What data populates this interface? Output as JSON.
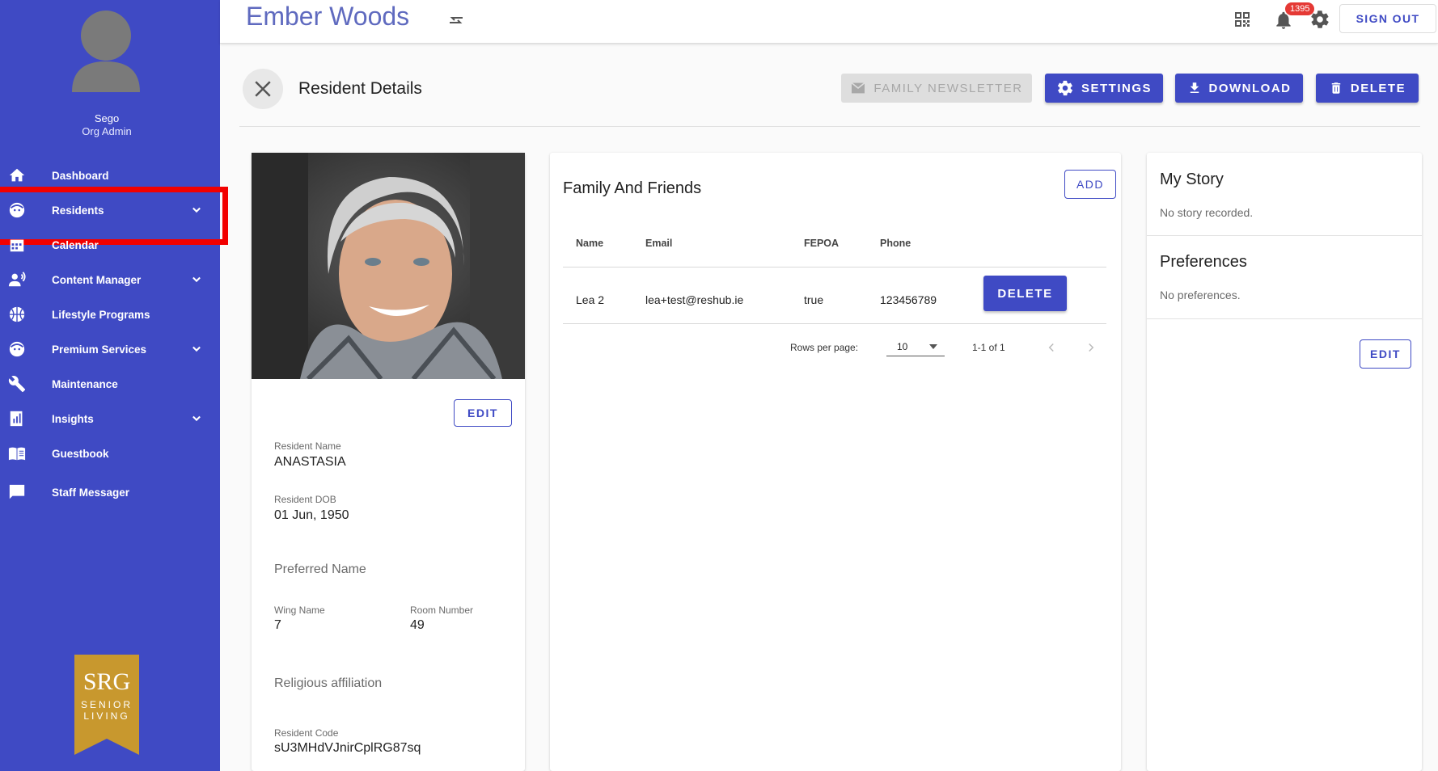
{
  "sidebar": {
    "user_name": "Sego",
    "user_role": "Org Admin",
    "items": [
      {
        "label": "Dashboard",
        "icon": "home-icon"
      },
      {
        "label": "Residents",
        "icon": "face-icon"
      },
      {
        "label": "Calendar",
        "icon": "calendar-icon"
      },
      {
        "label": "Content Manager",
        "icon": "person-voice-icon"
      },
      {
        "label": "Lifestyle Programs",
        "icon": "basketball-icon"
      },
      {
        "label": "Premium Services",
        "icon": "face-icon"
      },
      {
        "label": "Maintenance",
        "icon": "wrench-icon"
      },
      {
        "label": "Insights",
        "icon": "insights-icon"
      },
      {
        "label": "Guestbook",
        "icon": "book-icon"
      },
      {
        "label": "Staff Messager",
        "icon": "chat-icon"
      }
    ],
    "logo": {
      "line1": "SRG",
      "line2": "SENIOR",
      "line3": "LIVING"
    }
  },
  "topbar": {
    "title": "Ember Woods",
    "notification_count": "1395",
    "signout_label": "SIGN OUT"
  },
  "header": {
    "title": "Resident Details",
    "buttons": {
      "newsletter": "FAMILY NEWSLETTER",
      "settings": "SETTINGS",
      "download": "DOWNLOAD",
      "delete": "DELETE"
    }
  },
  "profile": {
    "edit_label": "EDIT",
    "resident_name_label": "Resident Name",
    "resident_name": "ANASTASIA",
    "dob_label": "Resident DOB",
    "dob": "01 Jun, 1950",
    "preferred_name_label": "Preferred Name",
    "wing_label": "Wing Name",
    "wing": "7",
    "room_label": "Room Number",
    "room": "49",
    "religion_label": "Religious affiliation",
    "code_label": "Resident Code",
    "code": "sU3MHdVJnirCplRG87sq"
  },
  "family": {
    "title": "Family And Friends",
    "add_label": "ADD",
    "columns": [
      "Name",
      "Email",
      "FEPOA",
      "Phone"
    ],
    "rows": [
      {
        "name": "Lea 2",
        "email": "lea+test@reshub.ie",
        "fepoa": "true",
        "phone": "123456789",
        "action": "DELETE"
      }
    ],
    "pagination": {
      "rows_per_page_label": "Rows per page:",
      "rows_per_page": "10",
      "range": "1-1 of 1"
    }
  },
  "story": {
    "title": "My Story",
    "empty": "No story recorded.",
    "pref_title": "Preferences",
    "pref_empty": "No preferences.",
    "edit_label": "EDIT"
  },
  "colors": {
    "primary": "#3f4ac4",
    "highlight": "#f20000",
    "badge": "#e53935"
  }
}
